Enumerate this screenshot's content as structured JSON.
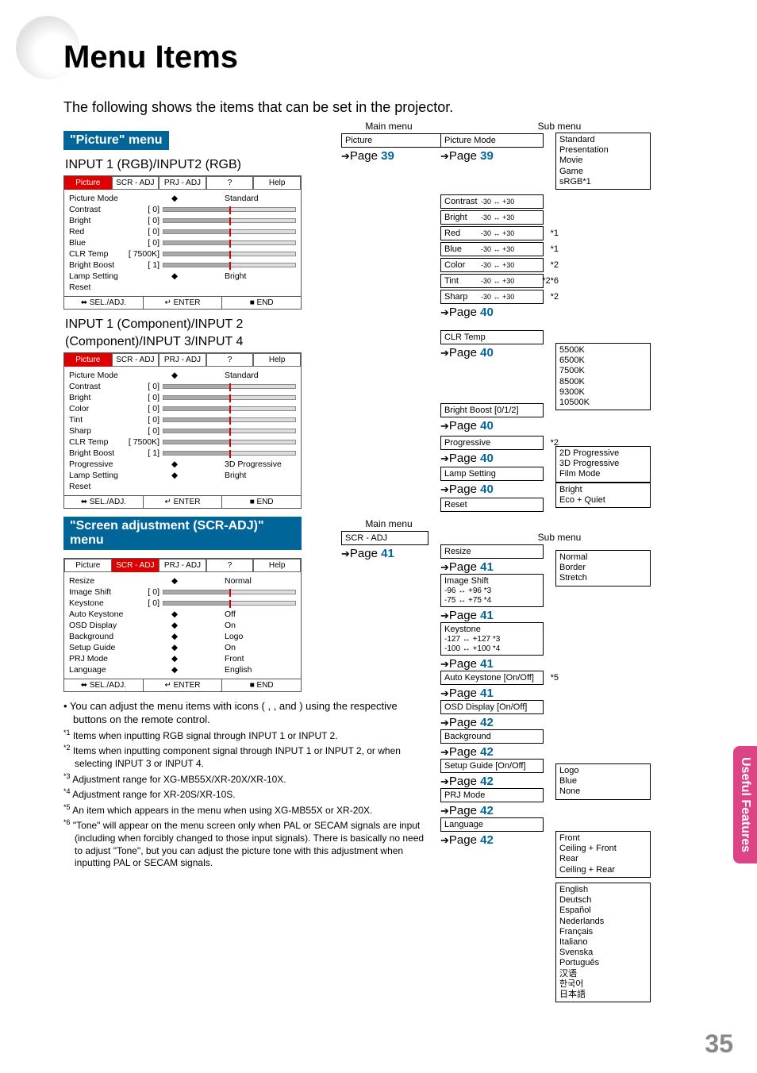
{
  "page": {
    "title": "Menu Items",
    "intro": "The following shows the items that can be set in the projector.",
    "number": "35"
  },
  "sidebar_tab": "Useful\nFeatures",
  "picture_menu": {
    "heading": "\"Picture\" menu",
    "sub1": "INPUT 1 (RGB)/INPUT2 (RGB)",
    "sub2_a": "INPUT 1 (Component)/INPUT 2",
    "sub2_b": "(Component)/INPUT 3/INPUT 4",
    "tabs": [
      "Picture",
      "SCR - ADJ",
      "PRJ - ADJ",
      "",
      "Help"
    ],
    "rows1": [
      {
        "lbl": "Picture Mode",
        "val": "",
        "rt": "Standard"
      },
      {
        "lbl": "Contrast",
        "val": "[      0]",
        "bar": true
      },
      {
        "lbl": "Bright",
        "val": "[      0]",
        "bar": true
      },
      {
        "lbl": "Red",
        "val": "[      0]",
        "bar": true
      },
      {
        "lbl": "Blue",
        "val": "[      0]",
        "bar": true
      },
      {
        "lbl": "CLR Temp",
        "val": "[ 7500K]",
        "bar": true
      },
      {
        "lbl": "Bright Boost",
        "val": "[      1]",
        "bar": true
      },
      {
        "lbl": "Lamp Setting",
        "val": "",
        "rt": "Bright"
      },
      {
        "lbl": "Reset",
        "val": "",
        "rt": ""
      }
    ],
    "rows2": [
      {
        "lbl": "Picture Mode",
        "val": "",
        "rt": "Standard"
      },
      {
        "lbl": "Contrast",
        "val": "[      0]",
        "bar": true
      },
      {
        "lbl": "Bright",
        "val": "[      0]",
        "bar": true
      },
      {
        "lbl": "Color",
        "val": "[      0]",
        "bar": true
      },
      {
        "lbl": "Tint",
        "val": "[      0]",
        "bar": true
      },
      {
        "lbl": "Sharp",
        "val": "[      0]",
        "bar": true
      },
      {
        "lbl": "CLR Temp",
        "val": "[ 7500K]",
        "bar": true
      },
      {
        "lbl": "Bright Boost",
        "val": "[      1]",
        "bar": true
      },
      {
        "lbl": "Progressive",
        "val": "",
        "rt": "3D Progressive"
      },
      {
        "lbl": "Lamp Setting",
        "val": "",
        "rt": "Bright"
      },
      {
        "lbl": "Reset",
        "val": "",
        "rt": ""
      }
    ],
    "ctrl": [
      "SEL./ADJ.",
      "ENTER",
      "END"
    ]
  },
  "scr_menu": {
    "heading": "\"Screen adjustment (SCR-ADJ)\" menu",
    "rows": [
      {
        "lbl": "Resize",
        "val": "",
        "rt": "Normal"
      },
      {
        "lbl": "Image Shift",
        "val": "[      0]",
        "bar": true
      },
      {
        "lbl": "Keystone",
        "val": "[      0]",
        "bar": true
      },
      {
        "lbl": "Auto Keystone",
        "val": "",
        "rt": "Off"
      },
      {
        "lbl": "OSD Display",
        "val": "",
        "rt": "On"
      },
      {
        "lbl": "Background",
        "val": "",
        "rt": "Logo"
      },
      {
        "lbl": "Setup Guide",
        "val": "",
        "rt": "On"
      },
      {
        "lbl": "PRJ Mode",
        "val": "",
        "rt": "Front"
      },
      {
        "lbl": "Language",
        "val": "",
        "rt": "English"
      }
    ]
  },
  "notes": {
    "bullet": "You can adjust the menu items with icons ( , , and ) using the respective buttons on the remote control.",
    "fns": [
      {
        "n": "*1",
        "t": "Items when inputting RGB signal through INPUT 1 or INPUT 2."
      },
      {
        "n": "*2",
        "t": "Items when inputting component signal through INPUT 1 or INPUT 2, or when selecting INPUT 3 or INPUT 4."
      },
      {
        "n": "*3",
        "t": "Adjustment range for XG-MB55X/XR-20X/XR-10X."
      },
      {
        "n": "*4",
        "t": "Adjustment range for XR-20S/XR-10S."
      },
      {
        "n": "*5",
        "t": "An item which appears in the menu when using XG-MB55X or XR-20X."
      },
      {
        "n": "*6",
        "t": "\"Tone\" will appear on the menu screen only when PAL or SECAM signals are input (including when forcibly changed to those input signals). There is basically no need to adjust \"Tone\", but you can adjust the picture tone with this adjustment when inputting PAL or SECAM signals."
      }
    ]
  },
  "tree": {
    "main_hdr": "Main menu",
    "sub_hdr": "Sub menu",
    "picture": {
      "label": "Picture",
      "page": "39"
    },
    "picmode": {
      "label": "Picture Mode",
      "page": "39",
      "sub": [
        "Standard",
        "Presentation",
        "Movie",
        "Game",
        "sRGB*1"
      ]
    },
    "adj": [
      {
        "l": "Contrast",
        "r": "-30 ↔ +30"
      },
      {
        "l": "Bright",
        "r": "-30 ↔ +30"
      },
      {
        "l": "Red",
        "r": "-30 ↔ +30",
        "n": "*1"
      },
      {
        "l": "Blue",
        "r": "-30 ↔ +30",
        "n": "*1"
      },
      {
        "l": "Color",
        "r": "-30 ↔ +30",
        "n": "*2"
      },
      {
        "l": "Tint",
        "r": "-30 ↔ +30",
        "n": "*2*6"
      },
      {
        "l": "Sharp",
        "r": "-30 ↔ +30",
        "n": "*2"
      }
    ],
    "adj_page": "40",
    "clr": {
      "label": "CLR Temp",
      "page": "40",
      "sub": [
        "5500K",
        "6500K",
        "7500K",
        "8500K",
        "9300K",
        "10500K"
      ]
    },
    "bb": {
      "label": "Bright Boost [0/1/2]",
      "page": "40"
    },
    "prog": {
      "label": "Progressive",
      "page": "40",
      "n": "*2",
      "sub": [
        "2D Progressive",
        "3D Progressive",
        "Film Mode"
      ]
    },
    "lamp": {
      "label": "Lamp Setting",
      "page": "40",
      "sub": [
        "Bright",
        "Eco + Quiet"
      ]
    },
    "reset": {
      "label": "Reset"
    },
    "main2_hdr": "Main menu",
    "scr": {
      "label": "SCR - ADJ",
      "page": "41"
    },
    "resize": {
      "label": "Resize",
      "page": "41",
      "sub": [
        "Normal",
        "Border",
        "Stretch"
      ]
    },
    "imgshift": {
      "label": "Image Shift",
      "l1": "-96 ↔ +96   *3",
      "l2": "-75 ↔ +75   *4",
      "page": "41"
    },
    "keystone": {
      "label": "Keystone",
      "l1": "-127 ↔ +127  *3",
      "l2": "-100 ↔ +100  *4",
      "page": "41"
    },
    "autok": {
      "label": "Auto Keystone [On/Off]",
      "n": "*5",
      "page": "41"
    },
    "osdd": {
      "label": "OSD Display [On/Off]",
      "page": "42"
    },
    "bg": {
      "label": "Background",
      "page": "42",
      "sub": [
        "Logo",
        "Blue",
        "None"
      ]
    },
    "sg": {
      "label": "Setup Guide [On/Off]",
      "page": "42"
    },
    "prj": {
      "label": "PRJ Mode",
      "page": "42",
      "sub": [
        "Front",
        "Ceiling + Front",
        "Rear",
        "Ceiling + Rear"
      ]
    },
    "lang": {
      "label": "Language",
      "page": "42",
      "sub": [
        "English",
        "Deutsch",
        "Español",
        "Nederlands",
        "Français",
        "Italiano",
        "Svenska",
        "Português",
        "汉语",
        "한국어",
        "日本語"
      ]
    }
  }
}
